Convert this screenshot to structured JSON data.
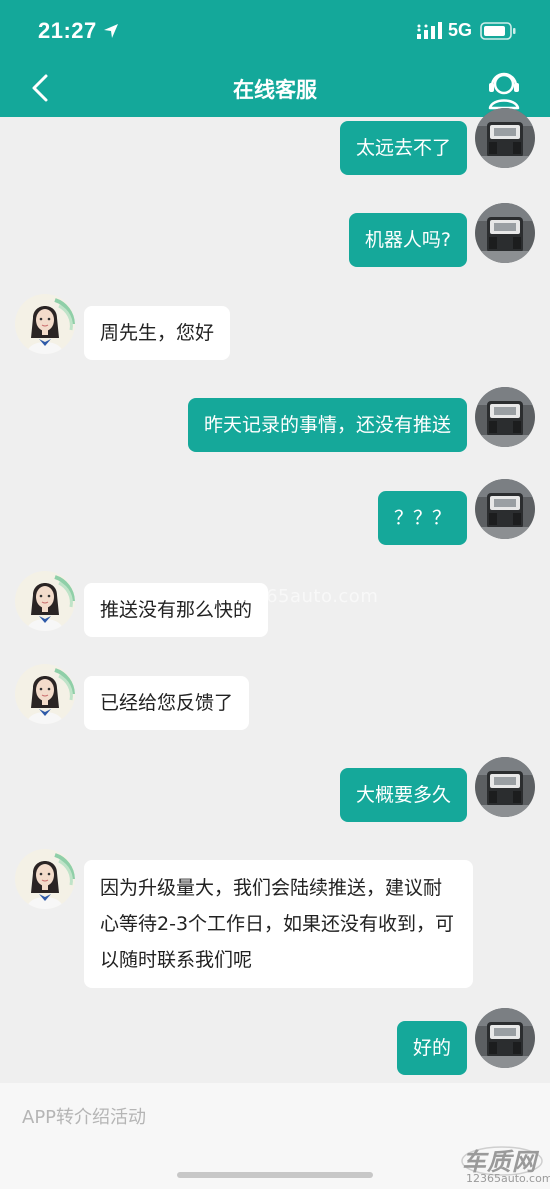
{
  "status_bar": {
    "time": "21:27",
    "network": "5G"
  },
  "header": {
    "title": "在线客服",
    "icons": {
      "back": "chevron-left-icon",
      "agent": "customer-service-headset-icon"
    }
  },
  "colors": {
    "brand": "#14a89a",
    "user_bubble": "#15a89a",
    "agent_bubble": "#ffffff",
    "background": "#efefef"
  },
  "messages": [
    {
      "from": "user",
      "text": "太远去不了"
    },
    {
      "from": "user",
      "text": "机器人吗?"
    },
    {
      "from": "agent",
      "text": "周先生，您好"
    },
    {
      "from": "user",
      "text": "昨天记录的事情，还没有推送"
    },
    {
      "from": "user",
      "text": "？？？"
    },
    {
      "from": "agent",
      "text": "推送没有那么快的"
    },
    {
      "from": "agent",
      "text": "已经给您反馈了"
    },
    {
      "from": "user",
      "text": "大概要多久"
    },
    {
      "from": "agent",
      "text": "因为升级量大，我们会陆续推送，建议耐心等待2-3个工作日，如果还没有收到，可以随时联系我们呢"
    },
    {
      "from": "user",
      "text": "好的"
    }
  ],
  "watermark": "www.12365auto.com",
  "footer": {
    "activity_link": "APP转介绍活动",
    "brand_name": "车质网",
    "brand_url": "12365auto.com"
  }
}
